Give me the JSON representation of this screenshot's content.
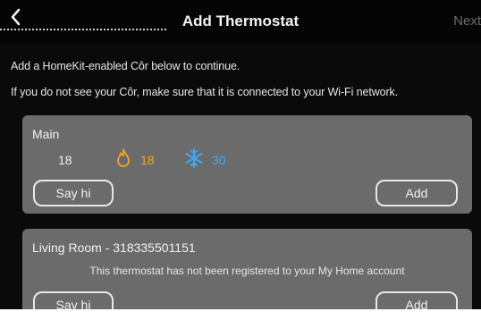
{
  "header": {
    "title": "Add Thermostat",
    "next_label": "Next",
    "back_icon": "chevron-left-icon"
  },
  "instructions": {
    "line1": "Add a HomeKit-enabled Côr below to continue.",
    "line2": "If you do not see your Côr, make sure that it is connected to your Wi-Fi network."
  },
  "devices": [
    {
      "name": "Main",
      "current_temp": "18",
      "heat_setpoint": "18",
      "cool_setpoint": "30",
      "say_hi_label": "Say hi",
      "add_label": "Add"
    },
    {
      "name": "Living Room - 318335501151",
      "note": "This thermostat has not been registered to your My Home account",
      "say_hi_label": "Say hi",
      "add_label": "Add"
    }
  ],
  "colors": {
    "background": "#0a0a0a",
    "card": "#6b6b6b",
    "heat": "#f0a52a",
    "cool": "#3fa9f5",
    "next_disabled": "#6e6e6e"
  }
}
